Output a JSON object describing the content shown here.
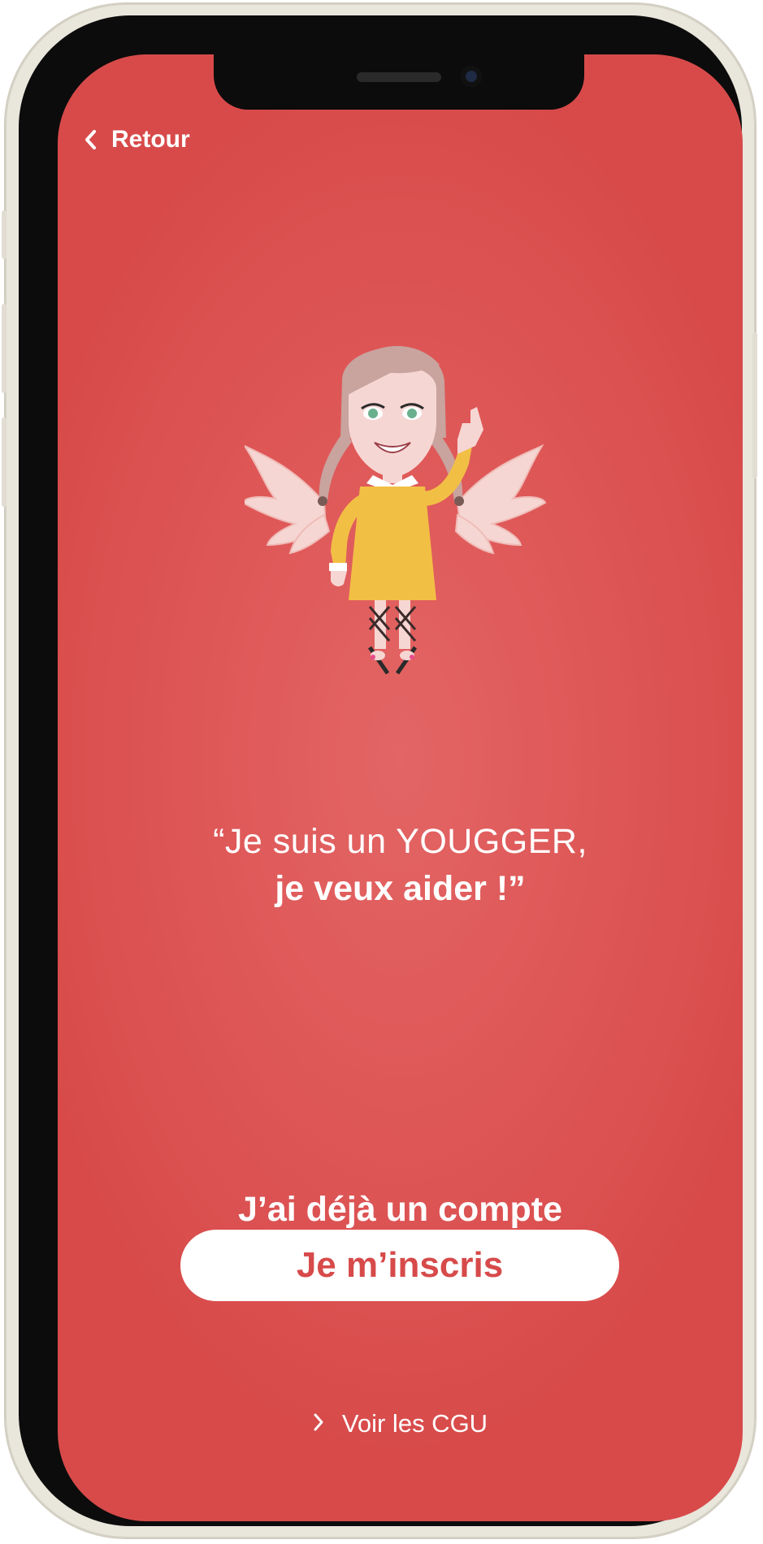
{
  "nav": {
    "back_label": "Retour",
    "back_icon": "chevron-left-icon"
  },
  "hero": {
    "quote_line1": "“Je suis un YOUGGER,",
    "quote_line2": "je veux aider !”"
  },
  "actions": {
    "login_label": "J’ai déjà un compte",
    "register_label": "Je m’inscris"
  },
  "footer": {
    "cgu_label": "Voir les CGU",
    "cgu_icon": "chevron-right-icon"
  },
  "colors": {
    "background": "#dc5252",
    "button_text": "#d74a4a",
    "dress": "#f2bf45",
    "wings": "#f6d6d3"
  }
}
